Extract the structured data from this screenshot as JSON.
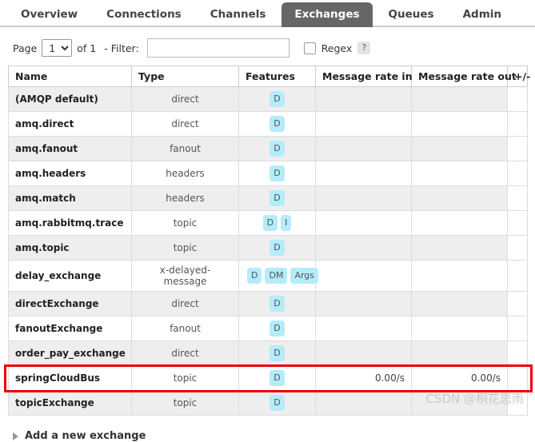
{
  "nav": {
    "tabs": [
      {
        "label": "Overview",
        "active": false
      },
      {
        "label": "Connections",
        "active": false
      },
      {
        "label": "Channels",
        "active": false
      },
      {
        "label": "Exchanges",
        "active": true
      },
      {
        "label": "Queues",
        "active": false
      },
      {
        "label": "Admin",
        "active": false
      }
    ]
  },
  "filterbar": {
    "page_label": "Page",
    "page_value": "1",
    "page_options": [
      "1"
    ],
    "of_label": "of 1",
    "filter_label": "- Filter:",
    "filter_value": "",
    "filter_placeholder": "",
    "regex_label": "Regex",
    "regex_checked": false,
    "help_label": "?"
  },
  "table": {
    "columns": [
      "Name",
      "Type",
      "Features",
      "Message rate in",
      "Message rate out"
    ],
    "plusminus_label": "+/-",
    "rows": [
      {
        "name": "(AMQP default)",
        "type": "direct",
        "features": [
          "D"
        ],
        "rate_in": "",
        "rate_out": "",
        "highlighted": false
      },
      {
        "name": "amq.direct",
        "type": "direct",
        "features": [
          "D"
        ],
        "rate_in": "",
        "rate_out": "",
        "highlighted": false
      },
      {
        "name": "amq.fanout",
        "type": "fanout",
        "features": [
          "D"
        ],
        "rate_in": "",
        "rate_out": "",
        "highlighted": false
      },
      {
        "name": "amq.headers",
        "type": "headers",
        "features": [
          "D"
        ],
        "rate_in": "",
        "rate_out": "",
        "highlighted": false
      },
      {
        "name": "amq.match",
        "type": "headers",
        "features": [
          "D"
        ],
        "rate_in": "",
        "rate_out": "",
        "highlighted": false
      },
      {
        "name": "amq.rabbitmq.trace",
        "type": "topic",
        "features": [
          "D",
          "I"
        ],
        "rate_in": "",
        "rate_out": "",
        "highlighted": false
      },
      {
        "name": "amq.topic",
        "type": "topic",
        "features": [
          "D"
        ],
        "rate_in": "",
        "rate_out": "",
        "highlighted": false
      },
      {
        "name": "delay_exchange",
        "type": "x-delayed-message",
        "features": [
          "D",
          "DM",
          "Args"
        ],
        "rate_in": "",
        "rate_out": "",
        "highlighted": false
      },
      {
        "name": "directExchange",
        "type": "direct",
        "features": [
          "D"
        ],
        "rate_in": "",
        "rate_out": "",
        "highlighted": false
      },
      {
        "name": "fanoutExchange",
        "type": "fanout",
        "features": [
          "D"
        ],
        "rate_in": "",
        "rate_out": "",
        "highlighted": false
      },
      {
        "name": "order_pay_exchange",
        "type": "direct",
        "features": [
          "D"
        ],
        "rate_in": "",
        "rate_out": "",
        "highlighted": false
      },
      {
        "name": "springCloudBus",
        "type": "topic",
        "features": [
          "D"
        ],
        "rate_in": "0.00/s",
        "rate_out": "0.00/s",
        "highlighted": true
      },
      {
        "name": "topicExchange",
        "type": "topic",
        "features": [
          "D"
        ],
        "rate_in": "",
        "rate_out": "",
        "highlighted": false
      }
    ]
  },
  "add_section": {
    "label": "Add a new exchange",
    "expanded": false
  },
  "watermark": {
    "text": "CSDN @桐花思雨"
  },
  "colors": {
    "active_tab_bg": "#666666",
    "badge_bg": "#b4ecfb",
    "highlight_border": "#ee0000",
    "row_odd_bg": "#eeeeee"
  }
}
